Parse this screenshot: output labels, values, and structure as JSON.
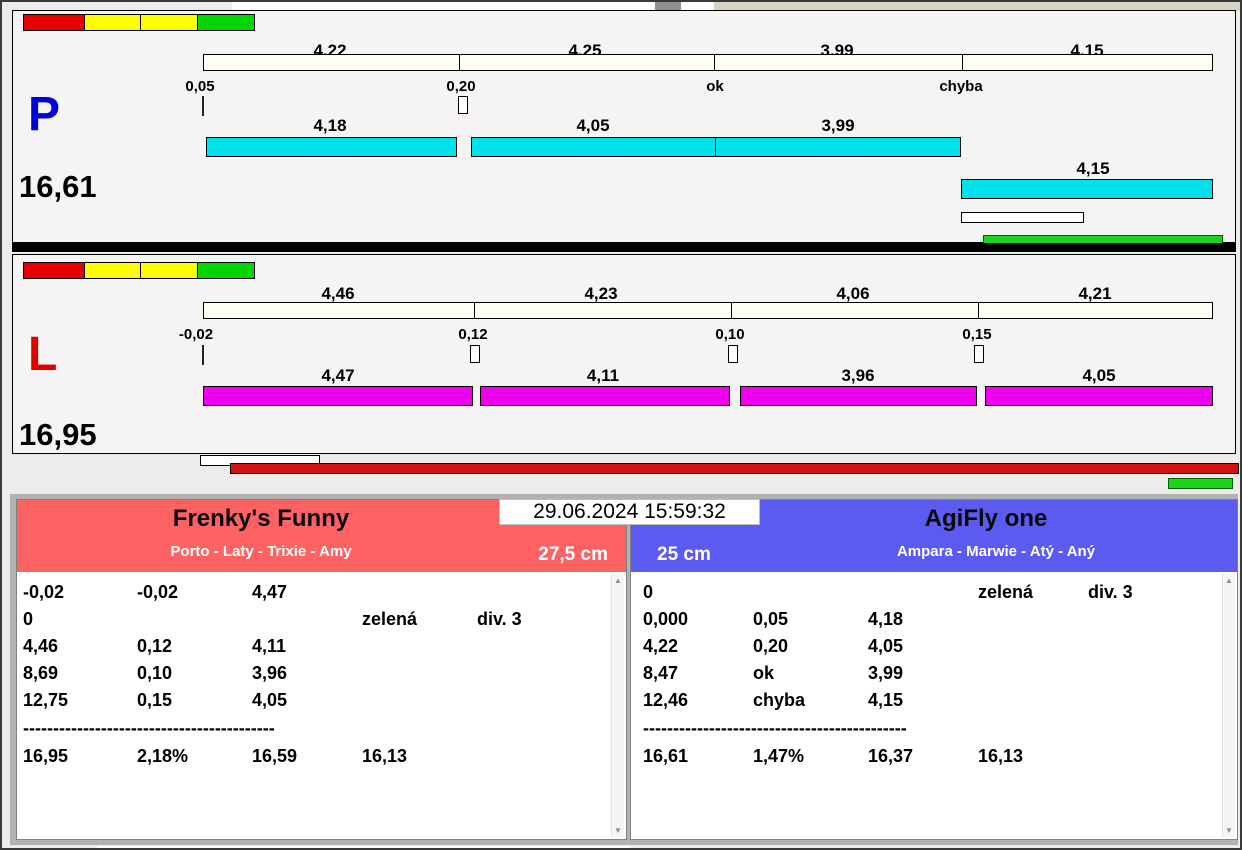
{
  "colors": {
    "lights": [
      "#e60000",
      "#ffff00",
      "#ffff00",
      "#00d500"
    ],
    "p_letter": "#0000d8",
    "p_bar": "#00e1ec",
    "l_letter": "#e00000",
    "l_bar": "#ee00ee",
    "green_bar": "#1bd41b",
    "red_bar": "#cf1212",
    "left_header": "#ff6262",
    "right_header": "#5b5bf2"
  },
  "timestamp": "29.06.2024 15:59:32",
  "lane_p": {
    "letter": "P",
    "total": "16,61",
    "top_values": [
      "4,22",
      "4,25",
      "3,99",
      "4,15"
    ],
    "tick_labels": [
      "0,05",
      "0,20",
      "ok",
      "chyba"
    ],
    "run_values": [
      "4,18",
      "4,05",
      "3,99"
    ],
    "last_value": "4,15"
  },
  "lane_l": {
    "letter": "L",
    "total": "16,95",
    "top_values": [
      "4,46",
      "4,23",
      "4,06",
      "4,21"
    ],
    "tick_labels": [
      "-0,02",
      "0,12",
      "0,10",
      "0,15"
    ],
    "run_values": [
      "4,47",
      "4,11",
      "3,96",
      "4,05"
    ]
  },
  "team_left": {
    "name": "Frenky's Funny",
    "members": "Porto - Laty - Trixie - Amy",
    "jump_height": "27,5 cm",
    "rows": [
      [
        "-0,02",
        "-0,02",
        "4,47",
        "",
        ""
      ],
      [
        "0",
        "",
        "",
        "zelená",
        "div. 3"
      ],
      [
        "4,46",
        "0,12",
        "4,11",
        "",
        ""
      ],
      [
        "8,69",
        "0,10",
        "3,96",
        "",
        ""
      ],
      [
        "12,75",
        "0,15",
        "4,05",
        "",
        ""
      ]
    ],
    "separator": "------------------------------------------",
    "summary": [
      "16,95",
      "2,18%",
      "16,59",
      "16,13"
    ]
  },
  "team_right": {
    "name": "AgiFly one",
    "members": "Ampara - Marwie - Atý - Aný",
    "jump_height": "25 cm",
    "rows": [
      [
        "0",
        "",
        "",
        "zelená",
        "div. 3"
      ],
      [
        "0,000",
        "0,05",
        "4,18",
        "",
        ""
      ],
      [
        "4,22",
        "0,20",
        "4,05",
        "",
        ""
      ],
      [
        "8,47",
        "ok",
        "3,99",
        "",
        ""
      ],
      [
        "12,46",
        "chyba",
        "4,15",
        "",
        ""
      ]
    ],
    "separator": "--------------------------------------------",
    "summary": [
      "16,61",
      "1,47%",
      "16,37",
      "16,13"
    ]
  }
}
